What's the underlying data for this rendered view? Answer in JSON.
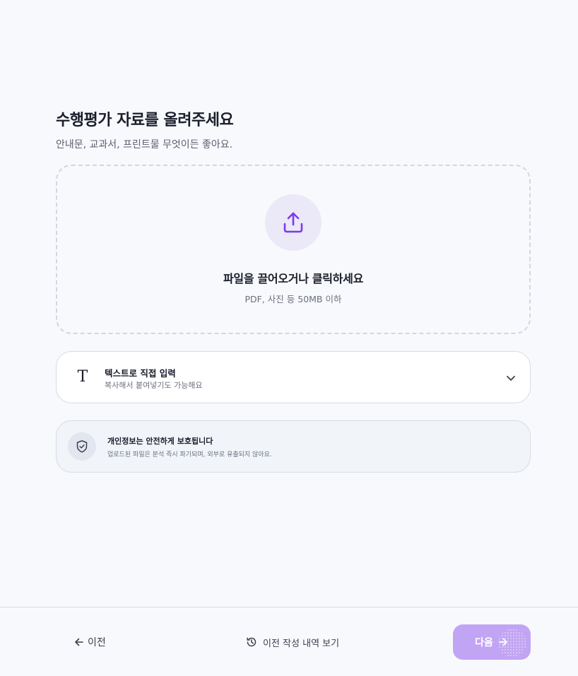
{
  "header": {
    "title": "수행평가 자료를 올려주세요",
    "subtitle": "안내문, 교과서, 프린트물 무엇이든 좋아요."
  },
  "dropzone": {
    "icon": "upload-icon",
    "title": "파일을 끌어오거나 클릭하세요",
    "hint": "PDF, 사진 등 50MB 이하"
  },
  "text_input": {
    "icon": "text-t-icon",
    "icon_glyph": "T",
    "title": "텍스트로 직접 입력",
    "subtitle": "복사해서 붙여넣기도 가능해요",
    "expand_icon": "chevron-down-icon"
  },
  "privacy": {
    "icon": "shield-check-icon",
    "title": "개인정보는 안전하게 보호됩니다",
    "subtitle": "업로드된 파일은 분석 즉시 파기되며, 외부로 유출되지 않아요."
  },
  "footer": {
    "back_label": "이전",
    "history_label": "이전 작성 내역 보기",
    "next_label": "다음"
  },
  "colors": {
    "accent": "#7c3aed",
    "accent_soft": "#ebe8f7",
    "next_button": "#c2a4f4",
    "background": "#f8f9fc"
  }
}
